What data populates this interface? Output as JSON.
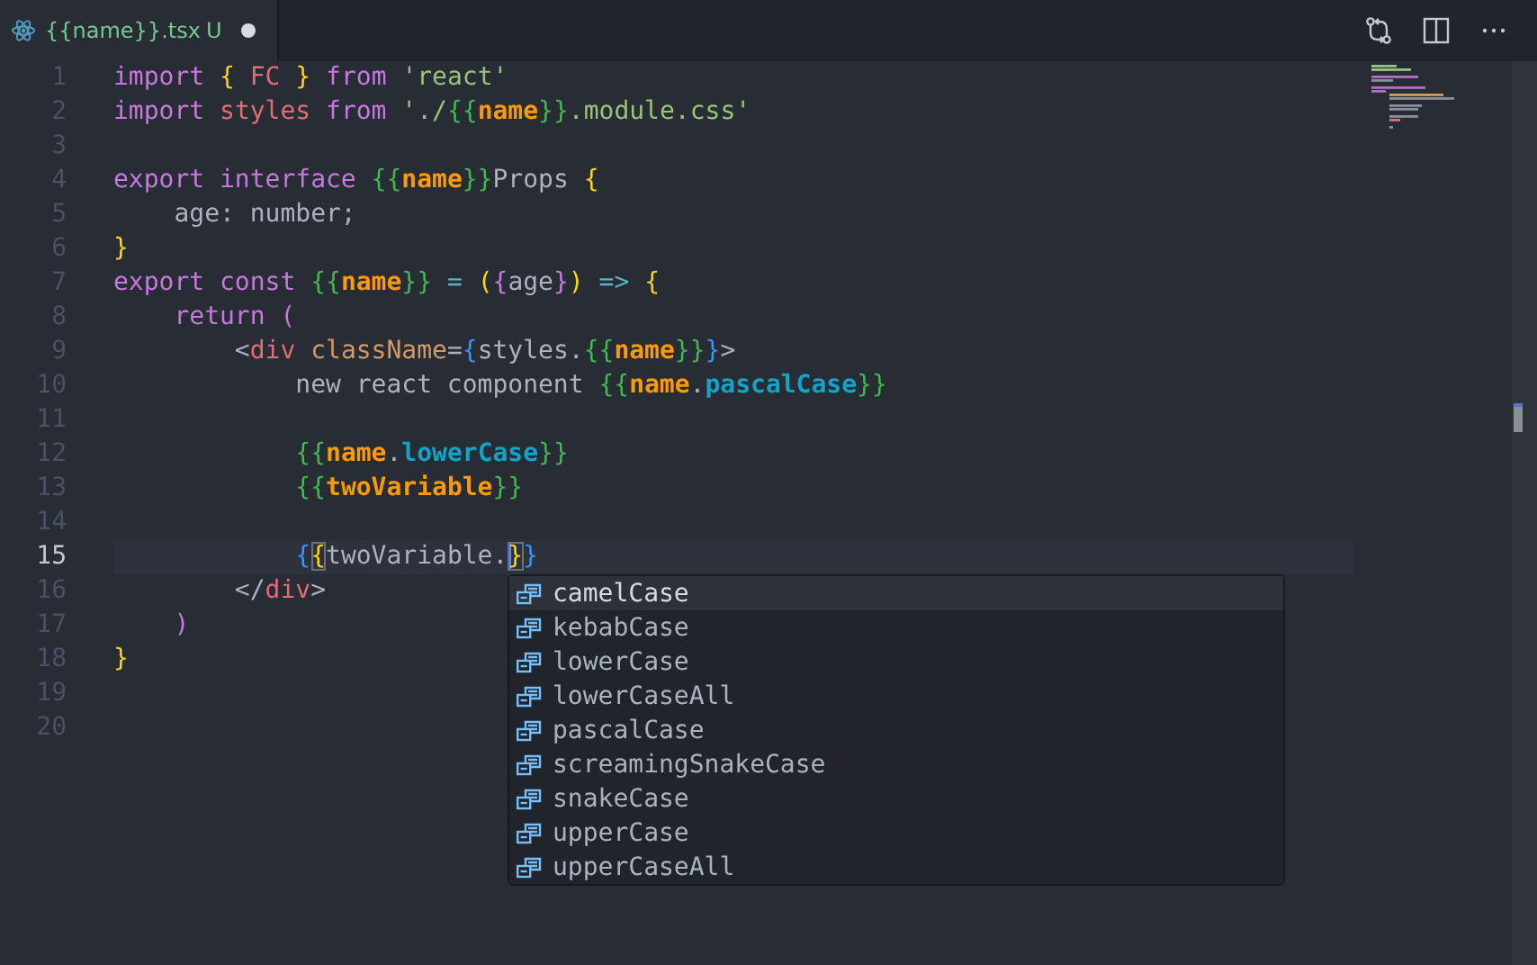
{
  "tab": {
    "title": "{{name}}.tsx",
    "status": "U",
    "modified": true,
    "selected": true
  },
  "lines": [
    {
      "number": "1",
      "current": false,
      "tokens": [
        {
          "text": "import ",
          "kind": "kw"
        },
        {
          "text": "{",
          "kind": "brace"
        },
        {
          "text": " FC ",
          "kind": "ident"
        },
        {
          "text": "}",
          "kind": "brace"
        },
        {
          "text": " from ",
          "kind": "kw"
        },
        {
          "text": "'react'",
          "kind": "str"
        }
      ]
    },
    {
      "number": "2",
      "current": false,
      "tokens": [
        {
          "text": "import ",
          "kind": "kw"
        },
        {
          "text": "styles",
          "kind": "ident"
        },
        {
          "text": " from ",
          "kind": "kw"
        },
        {
          "text": "'./",
          "kind": "str"
        },
        {
          "text": "{{",
          "kind": "tmpl"
        },
        {
          "text": "name",
          "kind": "var"
        },
        {
          "text": "}}",
          "kind": "tmpl"
        },
        {
          "text": ".module.css'",
          "kind": "str"
        }
      ]
    },
    {
      "number": "3",
      "current": false
    },
    {
      "number": "4",
      "current": false,
      "tokens": [
        {
          "text": "export interface ",
          "kind": "kw"
        },
        {
          "text": "{{",
          "kind": "tmpl"
        },
        {
          "text": "name",
          "kind": "var"
        },
        {
          "text": "}}",
          "kind": "tmpl"
        },
        {
          "text": "Props ",
          "kind": "text"
        },
        {
          "text": "{",
          "kind": "brace"
        }
      ]
    },
    {
      "number": "5",
      "current": false,
      "tokens": [
        {
          "text": "    age: number;",
          "kind": "text"
        }
      ]
    },
    {
      "number": "6",
      "current": false,
      "tokens": [
        {
          "text": "}",
          "kind": "brace"
        }
      ]
    },
    {
      "number": "7",
      "current": false,
      "tokens": [
        {
          "text": "export const ",
          "kind": "kw"
        },
        {
          "text": "{{",
          "kind": "tmpl"
        },
        {
          "text": "name",
          "kind": "var"
        },
        {
          "text": "}}",
          "kind": "tmpl"
        },
        {
          "text": " = ",
          "kind": "op"
        },
        {
          "text": "(",
          "kind": "brace"
        },
        {
          "text": "{",
          "kind": "paren"
        },
        {
          "text": "age",
          "kind": "text"
        },
        {
          "text": "}",
          "kind": "paren"
        },
        {
          "text": ")",
          "kind": "brace"
        },
        {
          "text": " => ",
          "kind": "op"
        },
        {
          "text": "{",
          "kind": "brace"
        }
      ]
    },
    {
      "number": "8",
      "current": false,
      "tokens": [
        {
          "text": "    return ",
          "kind": "kw"
        },
        {
          "text": "(",
          "kind": "paren"
        }
      ]
    },
    {
      "number": "9",
      "current": false,
      "tokens": [
        {
          "text": "        <",
          "kind": "punct"
        },
        {
          "text": "div",
          "kind": "tag"
        },
        {
          "text": " className",
          "kind": "attr"
        },
        {
          "text": "=",
          "kind": "punct"
        },
        {
          "text": "{",
          "kind": "blue"
        },
        {
          "text": "styles.",
          "kind": "text"
        },
        {
          "text": "{{",
          "kind": "tmpl"
        },
        {
          "text": "name",
          "kind": "var"
        },
        {
          "text": "}}",
          "kind": "tmpl"
        },
        {
          "text": "}",
          "kind": "blue"
        },
        {
          "text": ">",
          "kind": "punct"
        }
      ]
    },
    {
      "number": "10",
      "current": false,
      "tokens": [
        {
          "text": "            new react component ",
          "kind": "text"
        },
        {
          "text": "{{",
          "kind": "tmpl"
        },
        {
          "text": "name",
          "kind": "var"
        },
        {
          "text": ".",
          "kind": "text"
        },
        {
          "text": "pascalCase",
          "kind": "prop"
        },
        {
          "text": "}}",
          "kind": "tmpl"
        }
      ]
    },
    {
      "number": "11",
      "current": false
    },
    {
      "number": "12",
      "current": false,
      "tokens": [
        {
          "text": "            {{",
          "kind": "tmpl"
        },
        {
          "text": "name",
          "kind": "var"
        },
        {
          "text": ".",
          "kind": "text"
        },
        {
          "text": "lowerCase",
          "kind": "prop"
        },
        {
          "text": "}}",
          "kind": "tmpl"
        }
      ]
    },
    {
      "number": "13",
      "current": false,
      "tokens": [
        {
          "text": "            {{",
          "kind": "tmpl"
        },
        {
          "text": "twoVariable",
          "kind": "var"
        },
        {
          "text": "}}",
          "kind": "tmpl"
        }
      ]
    },
    {
      "number": "14",
      "current": false
    },
    {
      "number": "15",
      "current": true,
      "tokens": [
        {
          "text": "            {",
          "kind": "blue"
        },
        {
          "text": "{",
          "kind": "match"
        },
        {
          "text": "twoVariable.",
          "kind": "text"
        },
        {
          "text": "}",
          "kind": "cursor-match"
        },
        {
          "text": "}",
          "kind": "blue"
        }
      ]
    },
    {
      "number": "16",
      "current": false,
      "tokens": [
        {
          "text": "        </",
          "kind": "punct"
        },
        {
          "text": "div",
          "kind": "tag"
        },
        {
          "text": ">",
          "kind": "punct"
        }
      ]
    },
    {
      "number": "17",
      "current": false,
      "tokens": [
        {
          "text": "    )",
          "kind": "paren"
        }
      ]
    },
    {
      "number": "18",
      "current": false,
      "tokens": [
        {
          "text": "}",
          "kind": "brace"
        }
      ]
    },
    {
      "number": "19",
      "current": false
    },
    {
      "number": "20",
      "current": false
    }
  ],
  "suggestions": [
    {
      "label": "camelCase",
      "selected": true
    },
    {
      "label": "kebabCase",
      "selected": false
    },
    {
      "label": "lowerCase",
      "selected": false
    },
    {
      "label": "lowerCaseAll",
      "selected": false
    },
    {
      "label": "pascalCase",
      "selected": false
    },
    {
      "label": "screamingSnakeCase",
      "selected": false
    },
    {
      "label": "snakeCase",
      "selected": false
    },
    {
      "label": "upperCase",
      "selected": false
    },
    {
      "label": "upperCaseAll",
      "selected": false
    }
  ]
}
